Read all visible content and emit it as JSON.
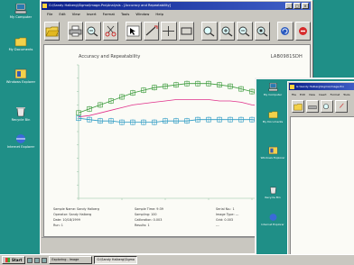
{
  "desktop": {
    "icons": [
      {
        "name": "my-computer",
        "label": "My Computer"
      },
      {
        "name": "my-documents",
        "label": "My Documents"
      },
      {
        "name": "windows-explorer",
        "label": "Windows Explorer"
      },
      {
        "name": "recycle-bin",
        "label": "Recycle Bin"
      },
      {
        "name": "internet-explorer",
        "label": "Internet Explorer"
      }
    ]
  },
  "window": {
    "title": "G:\\Sandy Halberg\\Sigma\\Image-Pro\\Analysis - [Accuracy and Repeatability]",
    "menu": [
      "File",
      "Edit",
      "View",
      "Insert",
      "Format",
      "Tools",
      "Window",
      "Help"
    ],
    "toolbar_icons": [
      "open-folder-icon",
      "print-icon",
      "zoom-out-icon",
      "scissors-icon",
      "select-arrow-icon",
      "line-tool-icon",
      "crosshair-icon",
      "rectangle-tool-icon",
      "zoom-in-icon",
      "zoom-in-plus-icon",
      "zoom-fit-icon",
      "zoom-selection-icon",
      "refresh-icon",
      "stop-icon"
    ]
  },
  "report": {
    "title": "Accuracy and Repeatability",
    "sample_id": "LAB0981SDH"
  },
  "chart_data": {
    "type": "line",
    "title": "Accuracy and Repeatability",
    "xlabel": "",
    "ylabel": "",
    "xlim": [
      0,
      20
    ],
    "ylim": [
      0,
      10
    ],
    "grid": false,
    "x": [
      0,
      1,
      2,
      3,
      4,
      5,
      6,
      7,
      8,
      9,
      10,
      11,
      12,
      13,
      14,
      15,
      16,
      17,
      18,
      19,
      20
    ],
    "series": [
      {
        "color": "#3a9a3a",
        "marker": "square",
        "values": [
          6.4,
          6.7,
          7.0,
          7.3,
          7.6,
          7.9,
          8.1,
          8.3,
          8.4,
          8.5,
          8.6,
          8.6,
          8.6,
          8.5,
          8.4,
          8.2,
          8.0,
          7.8,
          7.6,
          7.4,
          7.2
        ]
      },
      {
        "color": "#e0308a",
        "marker": "none",
        "values": [
          6.1,
          6.2,
          6.4,
          6.6,
          6.8,
          7.0,
          7.1,
          7.2,
          7.3,
          7.4,
          7.4,
          7.4,
          7.4,
          7.3,
          7.3,
          7.2,
          7.0,
          6.9,
          6.8,
          6.6,
          6.5
        ]
      },
      {
        "color": "#2a9ac4",
        "marker": "square",
        "values": [
          6.0,
          5.9,
          5.8,
          5.8,
          5.7,
          5.7,
          5.7,
          5.7,
          5.8,
          5.8,
          5.8,
          5.9,
          5.9,
          5.9,
          5.9,
          5.9,
          5.9,
          5.8,
          5.8,
          5.8,
          5.8
        ]
      }
    ]
  },
  "info": {
    "row1": [
      "Sample Name: Sandy Halberg",
      "Sample Time: 9:39",
      "Serial No.: 1"
    ],
    "row2": [
      "Operator: Sandy Halberg",
      "Sampling: 100",
      "Image Type: ---"
    ],
    "row3": [
      "Date: 10/18/1999",
      "Calibration: 0.003",
      "Grid: 0.003"
    ],
    "row4": [
      "Run: 1",
      "Results: 1",
      "---"
    ]
  },
  "taskbar": {
    "start_label": "Start",
    "tasks": [
      {
        "label": "Exploring - Image",
        "active": false
      },
      {
        "label": "G:\\Sandy Halberg\\Sigma",
        "active": true
      }
    ]
  },
  "second_window": {
    "title": "G:\\Sandy Halberg\\Sigma\\Image-Pro",
    "menu": [
      "File",
      "Edit",
      "View",
      "Insert",
      "Format",
      "Tools"
    ]
  },
  "colors": {
    "desktop": "#1f8f87",
    "titlebar": "#0a1f8a",
    "series_green": "#3a9a3a",
    "series_pink": "#e0308a",
    "series_blue": "#2a9ac4"
  }
}
